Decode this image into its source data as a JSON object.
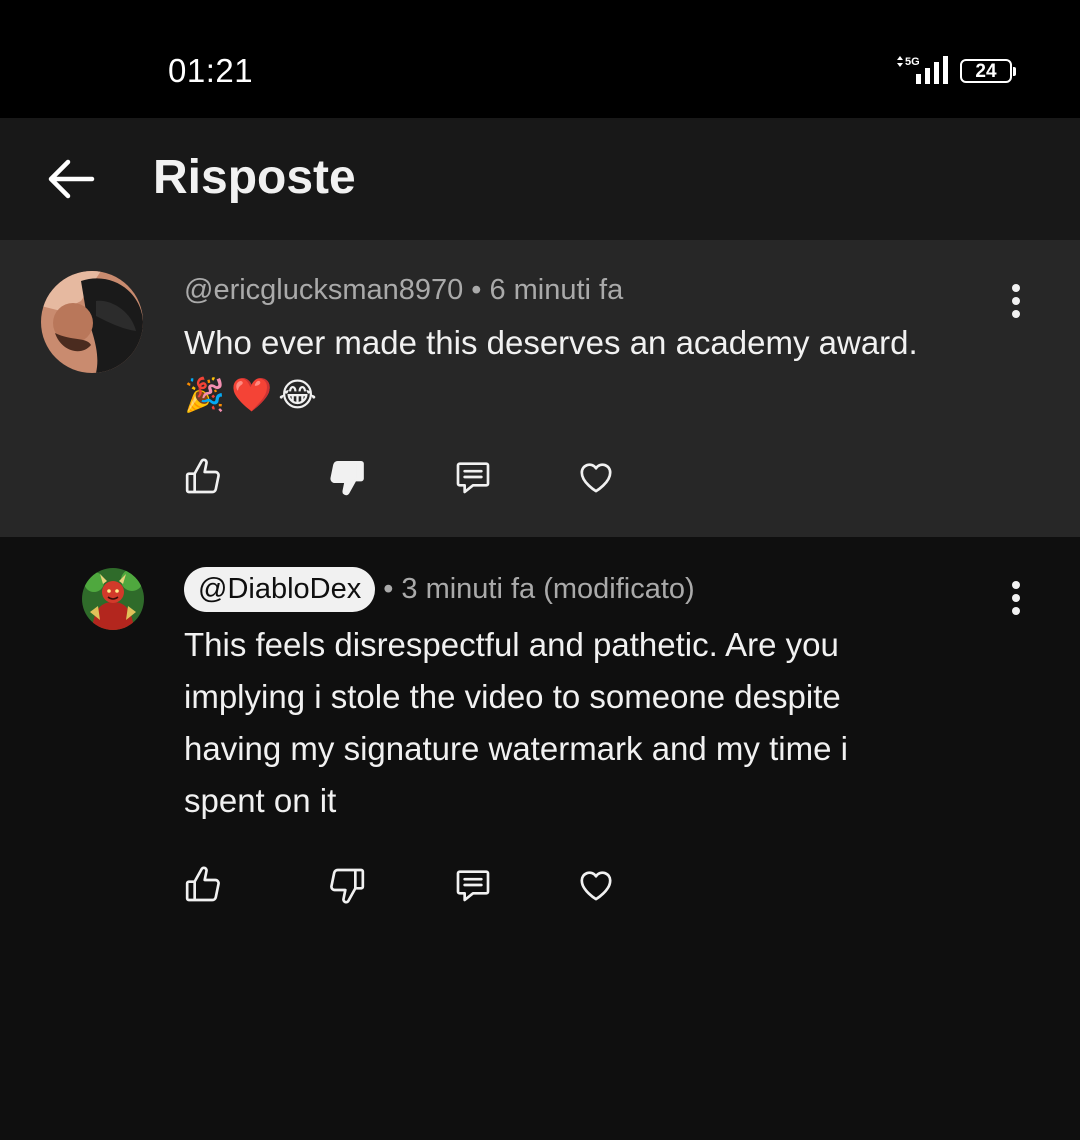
{
  "status_bar": {
    "time": "01:21",
    "network": "5G",
    "battery": "24"
  },
  "header": {
    "title": "Risposte",
    "back_icon": "arrow-left-icon"
  },
  "comments": [
    {
      "handle": "@ericglucksman8970",
      "separator": "•",
      "time": "6 minuti fa",
      "text": "Who ever made this deserves an academy award.",
      "emojis": [
        "🎉",
        "❤️",
        "😂"
      ],
      "disliked": true
    },
    {
      "handle": "@DiabloDex",
      "separator": "•",
      "time": "3 minuti fa (modificato)",
      "text_lines": [
        "This feels disrespectful and pathetic. Are you",
        "implying i stole the video to someone despite",
        "having my signature watermark and my time i",
        "spent on it"
      ],
      "disliked": false
    }
  ],
  "colors": {
    "background": "#0f0f0f",
    "highlight": "#272727",
    "header": "#181818",
    "text": "#f1f1f1",
    "meta": "#aaaaaa"
  },
  "icons": [
    "like-icon",
    "dislike-icon",
    "reply-icon",
    "heart-icon",
    "more-vert-icon"
  ]
}
